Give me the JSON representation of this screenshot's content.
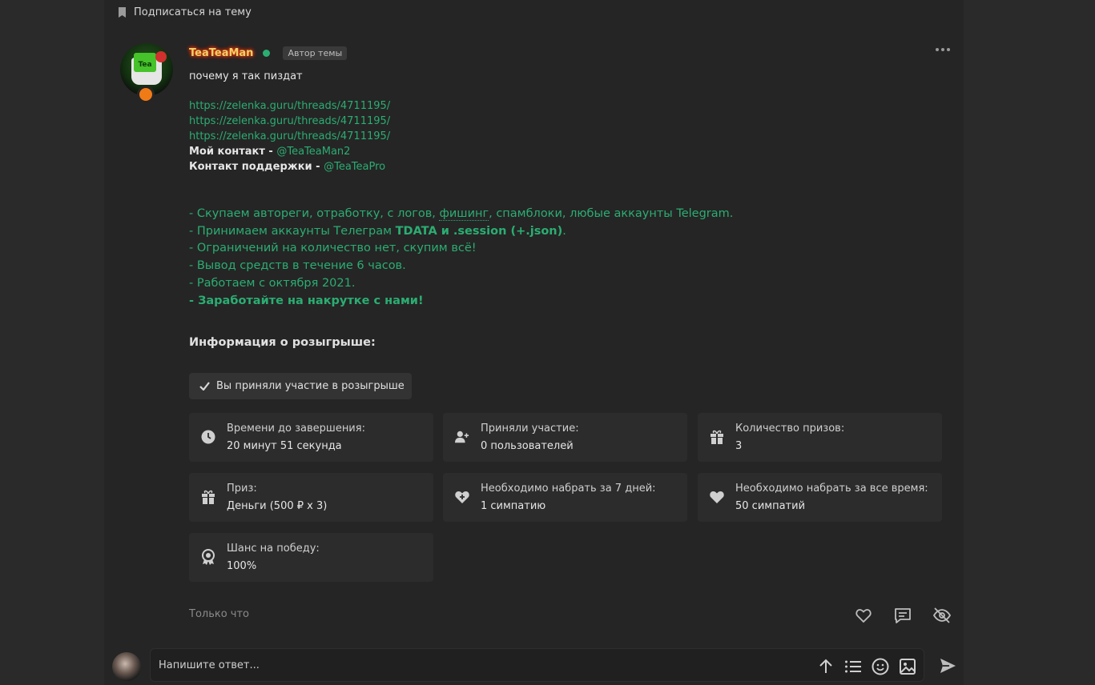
{
  "subscribe": {
    "label": "Подписаться на тему"
  },
  "post": {
    "username": "TeaTeaMan",
    "author_badge": "Автор темы",
    "message": "почему я так пиздат",
    "links": [
      "https://zelenka.guru/threads/4711195/",
      "https://zelenka.guru/threads/4711195/",
      "https://zelenka.guru/threads/4711195/"
    ],
    "my_contact_label": "Мой контакт - ",
    "my_contact_handle": "@TeaTeaMan2",
    "support_contact_label": "Контакт поддержки - ",
    "support_contact_handle": "@TeaTeaPro",
    "ad": {
      "line1_a": "- Скупаем автореги, отработку, с логов, ",
      "line1_b": "фишинг",
      "line1_c": ", спамблоки, любые аккаунты Telegram.",
      "line2_a": "- Принимаем аккаунты Телеграм ",
      "line2_b": "TDATA и .session (+.json)",
      "line2_c": ".",
      "line3": "- Ограничений на количество нет, скупим всё!",
      "line4": "- Вывод средств в течение 6 часов.",
      "line5": "- Работаем с октября 2021.",
      "line6": "- Заработайте на накрутке с нами!"
    },
    "giveaway_title": "Информация о розыгрыше:",
    "participated_label": "Вы приняли участие в розыгрыше",
    "cards": [
      {
        "label": "Времени до завершения:",
        "value": "20 минут 51 секунда",
        "icon": "clock-icon"
      },
      {
        "label": "Приняли участие:",
        "value": "0 пользователей",
        "icon": "user-plus-icon"
      },
      {
        "label": "Количество призов:",
        "value": "3",
        "icon": "gift-icon"
      },
      {
        "label": "Приз:",
        "value": "Деньги (500 ₽ x 3)",
        "icon": "gift-icon"
      },
      {
        "label": "Необходимо набрать за 7 дней:",
        "value": "1 симпатию",
        "icon": "heart-plus-icon"
      },
      {
        "label": "Необходимо набрать за все время:",
        "value": "50 симпатий",
        "icon": "heart-icon"
      },
      {
        "label": "Шанс на победу:",
        "value": "100%",
        "icon": "award-icon"
      }
    ],
    "time_ago": "Только что"
  },
  "reply": {
    "placeholder": "Напишите ответ..."
  },
  "colors": {
    "accent": "#2bad72",
    "background": "#252525",
    "card": "#2c2c2c",
    "status_orange": "#f07b16"
  }
}
